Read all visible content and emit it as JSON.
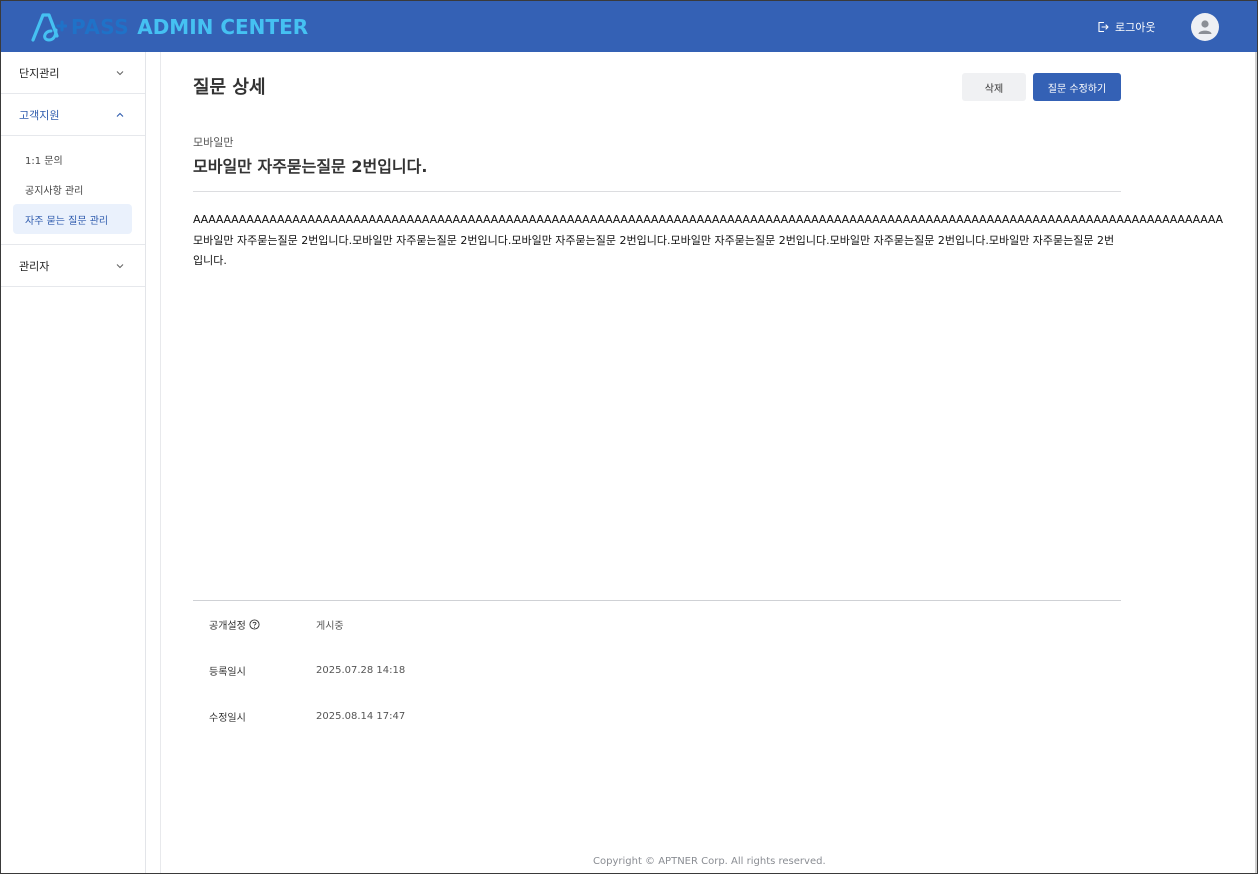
{
  "header": {
    "logo_pass": "PASS",
    "logo_admin": "ADMIN CENTER",
    "logout_label": "로그아웃",
    "brand_color": "#3461b5"
  },
  "sidebar": {
    "groups": [
      {
        "label": "단지관리",
        "expanded": false,
        "icon": "chevron-down-icon"
      },
      {
        "label": "고객지원",
        "expanded": true,
        "icon": "chevron-up-icon",
        "items": [
          {
            "label": "1:1 문의",
            "active": false
          },
          {
            "label": "공지사항 관리",
            "active": false
          },
          {
            "label": "자주 묻는 질문 관리",
            "active": true
          }
        ]
      },
      {
        "label": "관리자",
        "expanded": false,
        "icon": "chevron-down-icon"
      }
    ]
  },
  "page": {
    "title": "질문 상세",
    "delete_label": "삭제",
    "edit_label": "질문 수정하기"
  },
  "question": {
    "category": "모바일만",
    "title": "모바일만 자주묻는질문 2번입니다.",
    "body_line1": "AAAAAAAAAAAAAAAAAAAAAAAAAAAAAAAAAAAAAAAAAAAAAAAAAAAAAAAAAAAAAAAAAAAAAAAAAAAAAAAAAAAAAAAAAAAAAAAAAAAAAAAAAAAAAAAAAAAAAAAAAAAAAAAAAAAAAAA",
    "body_text": "모바일만 자주묻는질문 2번입니다.모바일만 자주묻는질문 2번입니다.모바일만 자주묻는질문 2번입니다.모바일만 자주묻는질문 2번입니다.모바일만 자주묻는질문 2번입니다.모바일만 자주묻는질문 2번입니다."
  },
  "meta": {
    "visibility_label": "공개설정",
    "visibility_value": "게시중",
    "created_label": "등록일시",
    "created_value": "2025.07.28 14:18",
    "updated_label": "수정일시",
    "updated_value": "2025.08.14 17:47"
  },
  "footer": {
    "copyright": "Copyright © APTNER Corp. All rights reserved."
  }
}
